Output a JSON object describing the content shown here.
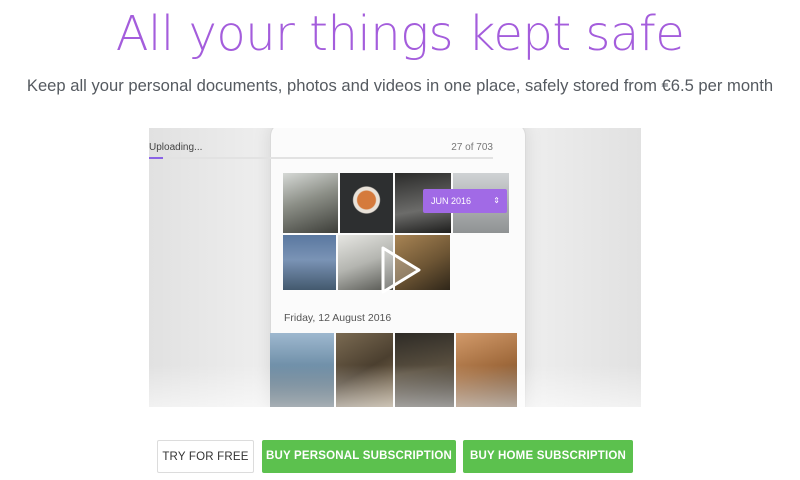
{
  "hero": {
    "title": "All your things kept safe",
    "subtitle": "Keep all your personal documents, photos and videos in one place, safely stored from €6.5 per month"
  },
  "video": {
    "upload_label": "Uploading...",
    "upload_count": "27 of 703",
    "upload_progress": 0.04,
    "date_chip": "JUN 2016",
    "date_chip_icon": "up-down-arrows-icon",
    "section_date": "Friday, 12 August 2016",
    "play_icon": "play-icon"
  },
  "actions": {
    "try_free": "TRY FOR FREE",
    "buy_personal": "BUY PERSONAL SUBSCRIPTION",
    "buy_home": "BUY HOME SUBSCRIPTION"
  },
  "colors": {
    "accent_purple": "#a45ddc",
    "cta_green": "#5cc14e"
  }
}
